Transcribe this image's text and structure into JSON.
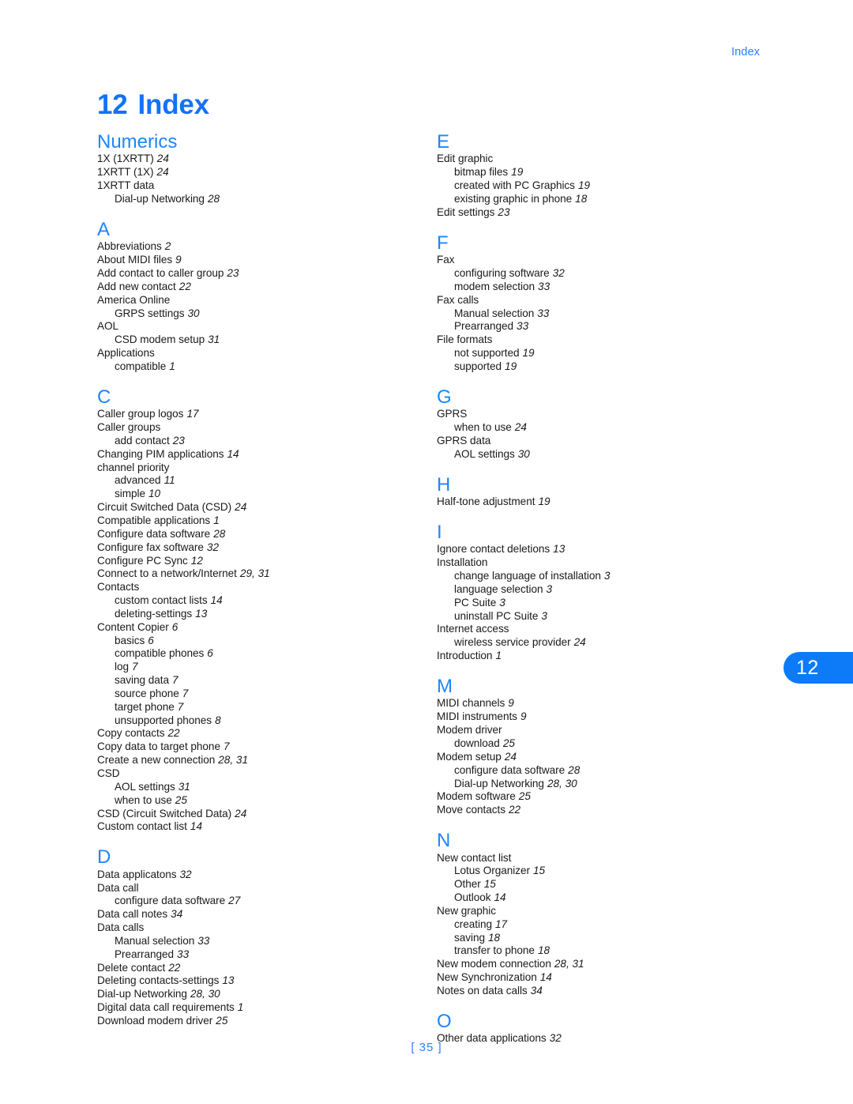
{
  "colors": {
    "accent_blue": "#1472f5",
    "heading_blue": "#1e86f7",
    "tab_blue": "#0d7bf7",
    "body_text": "#1a1a1a"
  },
  "running_header": "Index",
  "chapter": {
    "number": "12",
    "title": "Index"
  },
  "tab_marker": {
    "label": "12"
  },
  "footer": {
    "page_number": "[ 35 ]"
  },
  "columns": [
    {
      "id": "left",
      "sections": [
        {
          "letter": "Numerics",
          "entries": [
            {
              "text": "1X (1XRTT)",
              "pages": "24",
              "level": 0
            },
            {
              "text": "1XRTT (1X)",
              "pages": "24",
              "level": 0
            },
            {
              "text": "1XRTT data",
              "pages": "",
              "level": 0
            },
            {
              "text": "Dial-up Networking",
              "pages": "28",
              "level": 1
            }
          ]
        },
        {
          "letter": "A",
          "entries": [
            {
              "text": "Abbreviations",
              "pages": "2",
              "level": 0
            },
            {
              "text": "About MIDI files",
              "pages": "9",
              "level": 0
            },
            {
              "text": "Add contact to caller group",
              "pages": "23",
              "level": 0
            },
            {
              "text": "Add new contact",
              "pages": "22",
              "level": 0
            },
            {
              "text": "America Online",
              "pages": "",
              "level": 0
            },
            {
              "text": "GRPS settings",
              "pages": "30",
              "level": 1
            },
            {
              "text": "AOL",
              "pages": "",
              "level": 0
            },
            {
              "text": "CSD modem setup",
              "pages": "31",
              "level": 1
            },
            {
              "text": "Applications",
              "pages": "",
              "level": 0
            },
            {
              "text": "compatible",
              "pages": "1",
              "level": 1
            }
          ]
        },
        {
          "letter": "C",
          "entries": [
            {
              "text": "Caller group logos",
              "pages": "17",
              "level": 0
            },
            {
              "text": "Caller groups",
              "pages": "",
              "level": 0
            },
            {
              "text": "add contact",
              "pages": "23",
              "level": 1
            },
            {
              "text": "Changing PIM applications",
              "pages": "14",
              "level": 0
            },
            {
              "text": "channel priority",
              "pages": "",
              "level": 0
            },
            {
              "text": "advanced",
              "pages": "11",
              "level": 1
            },
            {
              "text": "simple",
              "pages": "10",
              "level": 1
            },
            {
              "text": "Circuit Switched Data (CSD)",
              "pages": "24",
              "level": 0
            },
            {
              "text": "Compatible applications",
              "pages": "1",
              "level": 0
            },
            {
              "text": "Configure data software",
              "pages": "28",
              "level": 0
            },
            {
              "text": "Configure fax software",
              "pages": "32",
              "level": 0
            },
            {
              "text": "Configure PC Sync",
              "pages": "12",
              "level": 0
            },
            {
              "text": "Connect to a network/Internet",
              "pages": "29, 31",
              "level": 0
            },
            {
              "text": "Contacts",
              "pages": "",
              "level": 0
            },
            {
              "text": "custom contact lists",
              "pages": "14",
              "level": 1
            },
            {
              "text": "deleting-settings",
              "pages": "13",
              "level": 1
            },
            {
              "text": "Content Copier",
              "pages": "6",
              "level": 0
            },
            {
              "text": "basics",
              "pages": "6",
              "level": 1
            },
            {
              "text": "compatible phones",
              "pages": "6",
              "level": 1
            },
            {
              "text": "log",
              "pages": "7",
              "level": 1
            },
            {
              "text": "saving data",
              "pages": "7",
              "level": 1
            },
            {
              "text": "source phone",
              "pages": "7",
              "level": 1
            },
            {
              "text": "target phone",
              "pages": "7",
              "level": 1
            },
            {
              "text": "unsupported phones",
              "pages": "8",
              "level": 1
            },
            {
              "text": "Copy contacts",
              "pages": "22",
              "level": 0
            },
            {
              "text": "Copy data to target phone",
              "pages": "7",
              "level": 0
            },
            {
              "text": "Create a new connection",
              "pages": "28, 31",
              "level": 0
            },
            {
              "text": "CSD",
              "pages": "",
              "level": 0
            },
            {
              "text": "AOL settings",
              "pages": "31",
              "level": 1
            },
            {
              "text": "when to use",
              "pages": "25",
              "level": 1
            },
            {
              "text": "CSD (Circuit Switched Data)",
              "pages": "24",
              "level": 0
            },
            {
              "text": "Custom contact list",
              "pages": "14",
              "level": 0
            }
          ]
        },
        {
          "letter": "D",
          "entries": [
            {
              "text": "Data applicatons",
              "pages": "32",
              "level": 0
            },
            {
              "text": "Data call",
              "pages": "",
              "level": 0
            },
            {
              "text": "configure data software",
              "pages": "27",
              "level": 1
            },
            {
              "text": "Data call notes",
              "pages": "34",
              "level": 0
            },
            {
              "text": "Data calls",
              "pages": "",
              "level": 0
            },
            {
              "text": "Manual selection",
              "pages": "33",
              "level": 1
            },
            {
              "text": "Prearranged",
              "pages": "33",
              "level": 1
            },
            {
              "text": "Delete contact",
              "pages": "22",
              "level": 0
            },
            {
              "text": "Deleting contacts-settings",
              "pages": "13",
              "level": 0
            },
            {
              "text": "Dial-up Networking",
              "pages": "28, 30",
              "level": 0
            },
            {
              "text": "Digital data call requirements",
              "pages": "1",
              "level": 0
            },
            {
              "text": "Download modem driver",
              "pages": "25",
              "level": 0
            }
          ]
        }
      ]
    },
    {
      "id": "right",
      "sections": [
        {
          "letter": "E",
          "entries": [
            {
              "text": "Edit graphic",
              "pages": "",
              "level": 0
            },
            {
              "text": "bitmap files",
              "pages": "19",
              "level": 1
            },
            {
              "text": "created with PC Graphics",
              "pages": "19",
              "level": 1
            },
            {
              "text": "existing graphic in phone",
              "pages": "18",
              "level": 1
            },
            {
              "text": "Edit settings",
              "pages": "23",
              "level": 0
            }
          ]
        },
        {
          "letter": "F",
          "entries": [
            {
              "text": "Fax",
              "pages": "",
              "level": 0
            },
            {
              "text": "configuring software",
              "pages": "32",
              "level": 1
            },
            {
              "text": "modem selection",
              "pages": "33",
              "level": 1
            },
            {
              "text": "Fax calls",
              "pages": "",
              "level": 0
            },
            {
              "text": "Manual selection",
              "pages": "33",
              "level": 1
            },
            {
              "text": "Prearranged",
              "pages": "33",
              "level": 1
            },
            {
              "text": "File formats",
              "pages": "",
              "level": 0
            },
            {
              "text": "not supported",
              "pages": "19",
              "level": 1
            },
            {
              "text": "supported",
              "pages": "19",
              "level": 1
            }
          ]
        },
        {
          "letter": "G",
          "entries": [
            {
              "text": "GPRS",
              "pages": "",
              "level": 0
            },
            {
              "text": "when to use",
              "pages": "24",
              "level": 1
            },
            {
              "text": "GPRS data",
              "pages": "",
              "level": 0
            },
            {
              "text": "AOL settings",
              "pages": "30",
              "level": 1
            }
          ]
        },
        {
          "letter": "H",
          "entries": [
            {
              "text": "Half-tone adjustment",
              "pages": "19",
              "level": 0
            }
          ]
        },
        {
          "letter": "I",
          "entries": [
            {
              "text": "Ignore contact deletions",
              "pages": "13",
              "level": 0
            },
            {
              "text": "Installation",
              "pages": "",
              "level": 0
            },
            {
              "text": "change language of installation",
              "pages": "3",
              "level": 1
            },
            {
              "text": "language selection",
              "pages": "3",
              "level": 1
            },
            {
              "text": "PC Suite",
              "pages": "3",
              "level": 1
            },
            {
              "text": "uninstall PC Suite",
              "pages": "3",
              "level": 1
            },
            {
              "text": "Internet access",
              "pages": "",
              "level": 0
            },
            {
              "text": "wireless service provider",
              "pages": "24",
              "level": 1
            },
            {
              "text": "Introduction",
              "pages": "1",
              "level": 0
            }
          ]
        },
        {
          "letter": "M",
          "entries": [
            {
              "text": "MIDI channels",
              "pages": "9",
              "level": 0
            },
            {
              "text": "MIDI instruments",
              "pages": "9",
              "level": 0
            },
            {
              "text": "Modem driver",
              "pages": "",
              "level": 0
            },
            {
              "text": "download",
              "pages": "25",
              "level": 1
            },
            {
              "text": "Modem setup",
              "pages": "24",
              "level": 0
            },
            {
              "text": "configure data software",
              "pages": "28",
              "level": 1
            },
            {
              "text": "Dial-up Networking",
              "pages": "28, 30",
              "level": 1
            },
            {
              "text": "Modem software",
              "pages": "25",
              "level": 0
            },
            {
              "text": "Move contacts",
              "pages": "22",
              "level": 0
            }
          ]
        },
        {
          "letter": "N",
          "entries": [
            {
              "text": "New contact list",
              "pages": "",
              "level": 0
            },
            {
              "text": "Lotus Organizer",
              "pages": "15",
              "level": 1
            },
            {
              "text": "Other",
              "pages": "15",
              "level": 1
            },
            {
              "text": "Outlook",
              "pages": "14",
              "level": 1
            },
            {
              "text": "New graphic",
              "pages": "",
              "level": 0
            },
            {
              "text": "creating",
              "pages": "17",
              "level": 1
            },
            {
              "text": "saving",
              "pages": "18",
              "level": 1
            },
            {
              "text": "transfer to phone",
              "pages": "18",
              "level": 1
            },
            {
              "text": "New modem connection",
              "pages": "28, 31",
              "level": 0
            },
            {
              "text": "New Synchronization",
              "pages": "14",
              "level": 0
            },
            {
              "text": "Notes on data calls",
              "pages": "34",
              "level": 0
            }
          ]
        },
        {
          "letter": "O",
          "entries": [
            {
              "text": "Other data applications",
              "pages": "32",
              "level": 0
            }
          ]
        }
      ]
    }
  ]
}
